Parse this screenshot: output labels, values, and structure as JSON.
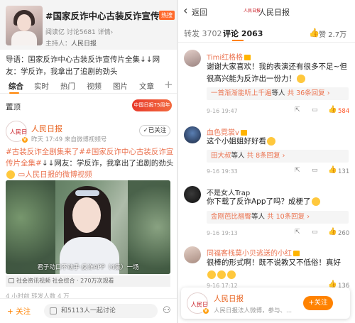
{
  "left": {
    "topic": {
      "title": "#国家反诈中心古装反诈宣传...",
      "hot_badge": "热搜",
      "stats": "阅读亿  讨论5681  详情›",
      "host_label": "主持人：",
      "host_name": "人民日报"
    },
    "guide_text": "导语：国家反诈中心古装反诈宣传片全集↓↓网友：学反诈，我拿出了追剧的劲头",
    "tabs": [
      "综合",
      "实时",
      "热门",
      "视频",
      "图片",
      "文章"
    ],
    "tab_plus": "+",
    "section_label": "置顶",
    "anniv_badge": "中国日报75周年",
    "post": {
      "avatar_text": "人民日报",
      "author": "人民日报",
      "meta": "昨天 17:49  来自微博视频号",
      "follow_label": "已关注",
      "hashtag": "#古装反诈全剧集来了#",
      "hashtag2": "#国家反诈中心古装反诈宣传片全集#",
      "body": "↓↓网友：学反诈，我拿出了追剧的劲头",
      "video_link": "人民日报的微博视频",
      "video_caption": "君子动口不动手·反诈APP（4集）一场",
      "video_meta": "社会资讯视频  社会综合 · 270万次观看",
      "stats": "4 小时前  转发人数  4 万"
    },
    "bottom_bar": {
      "follow_label": "+ 关注",
      "input_placeholder": "和5113人一起讨论",
      "share_icon": "share-icon"
    }
  },
  "right": {
    "nav": {
      "back_label": "返回",
      "logo_text": "人民日报",
      "title": "人民日报"
    },
    "tabs": {
      "repost": "转发 3702",
      "comment": "评论 2063",
      "like": "赞 2.7万"
    },
    "comments": [
      {
        "name": "Timi红格格",
        "text": "谢谢大家喜欢！我的表演还有很多不足~但很高兴能为反诈出一份力！",
        "reply_user": "一首渐渐能听上千遍",
        "reply_mid": "等人",
        "reply_count": "共 36条回复 ›",
        "time": "9-16 19:47",
        "likes": "584",
        "hot": true
      },
      {
        "name": "血色霓裳v",
        "text": "这个小姐姐好好看",
        "reply_user": "田大叔",
        "reply_mid": "等人",
        "reply_count": "共 8条回复 ›",
        "time": "9-16 19:33",
        "likes": "131",
        "hot": false
      },
      {
        "name": "不是女人Trap",
        "text": "你下载了反诈App了吗？成梗了",
        "reply_user": "金刚芭比翘臀",
        "reply_mid": "等人",
        "reply_count": "共 10条回复 ›",
        "time": "9-16 19:13",
        "likes": "260",
        "hot": false
      },
      {
        "name": "同福客栈莫小贝逃送的小红",
        "text": "很棒的形式啊！既不说教又不低俗！真好",
        "reply_user": "",
        "reply_mid": "",
        "reply_count": "",
        "time": "9-16 17:12",
        "likes": "136",
        "hot": false
      }
    ],
    "popup": {
      "avatar_text": "人民日报",
      "name": "人民日报",
      "desc": "人民日报法人微博，参与、...",
      "follow_label": "+关注"
    }
  },
  "colors": {
    "accent_orange": "#ff8200",
    "link_orange": "#eb7350",
    "brand_red": "#c7161e"
  }
}
